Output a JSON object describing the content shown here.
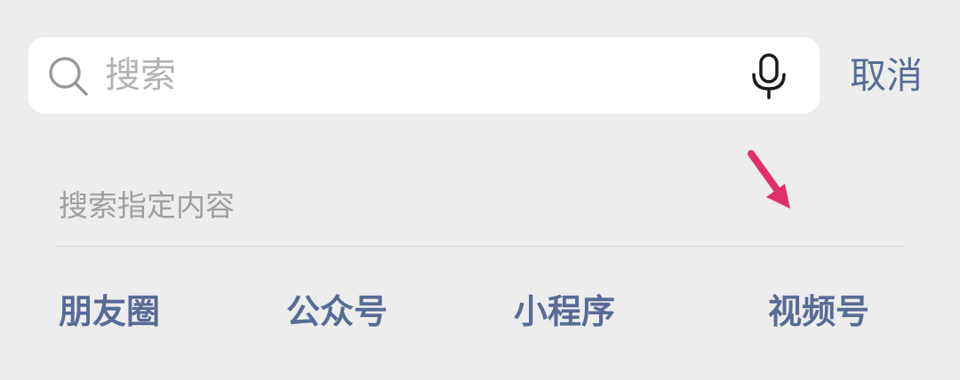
{
  "search": {
    "placeholder": "搜索",
    "value": "",
    "search_icon": "search-icon",
    "mic_icon": "microphone-icon"
  },
  "header": {
    "cancel_label": "取消"
  },
  "section": {
    "title": "搜索指定内容"
  },
  "categories": [
    {
      "label": "朋友圈"
    },
    {
      "label": "公众号"
    },
    {
      "label": "小程序"
    },
    {
      "label": "视频号"
    }
  ],
  "annotation": {
    "icon": "arrow-icon",
    "color": "#e0306c"
  },
  "colors": {
    "background": "#ededed",
    "link": "#576b95",
    "placeholder": "#b2b2b2",
    "muted_text": "#9f9f9f"
  }
}
